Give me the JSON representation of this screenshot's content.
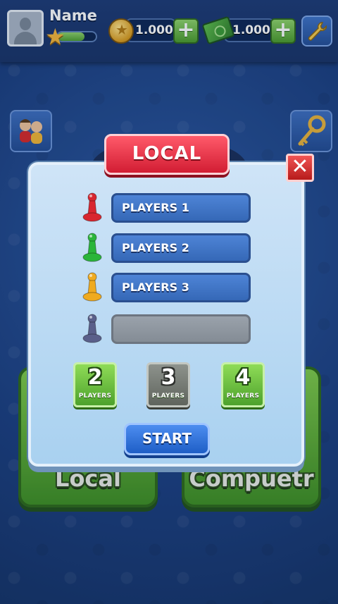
{
  "header": {
    "profile_name": "Name",
    "xp_progress": 0.7,
    "coins": "1.000",
    "cash": "1.000"
  },
  "menu": {
    "local_label": "Local",
    "computer_label": "Compuetr"
  },
  "dialog": {
    "title": "LOCAL",
    "players": [
      {
        "label": "PLAYERS 1",
        "color": "#d8262f"
      },
      {
        "label": "PLAYERS 2",
        "color": "#2bb53a"
      },
      {
        "label": "PLAYERS 3",
        "color": "#efaa1f"
      },
      {
        "label": "",
        "color": "#5a5f8a"
      }
    ],
    "player_counts": [
      {
        "number": "2",
        "label": "PLAYERS",
        "selected": false
      },
      {
        "number": "3",
        "label": "PLAYERS",
        "selected": true
      },
      {
        "number": "4",
        "label": "PLAYERS",
        "selected": false
      }
    ],
    "start_label": "START"
  },
  "colors": {
    "accent_green": "#4da22c",
    "accent_blue": "#1e5ec6",
    "accent_red": "#d21d33"
  }
}
